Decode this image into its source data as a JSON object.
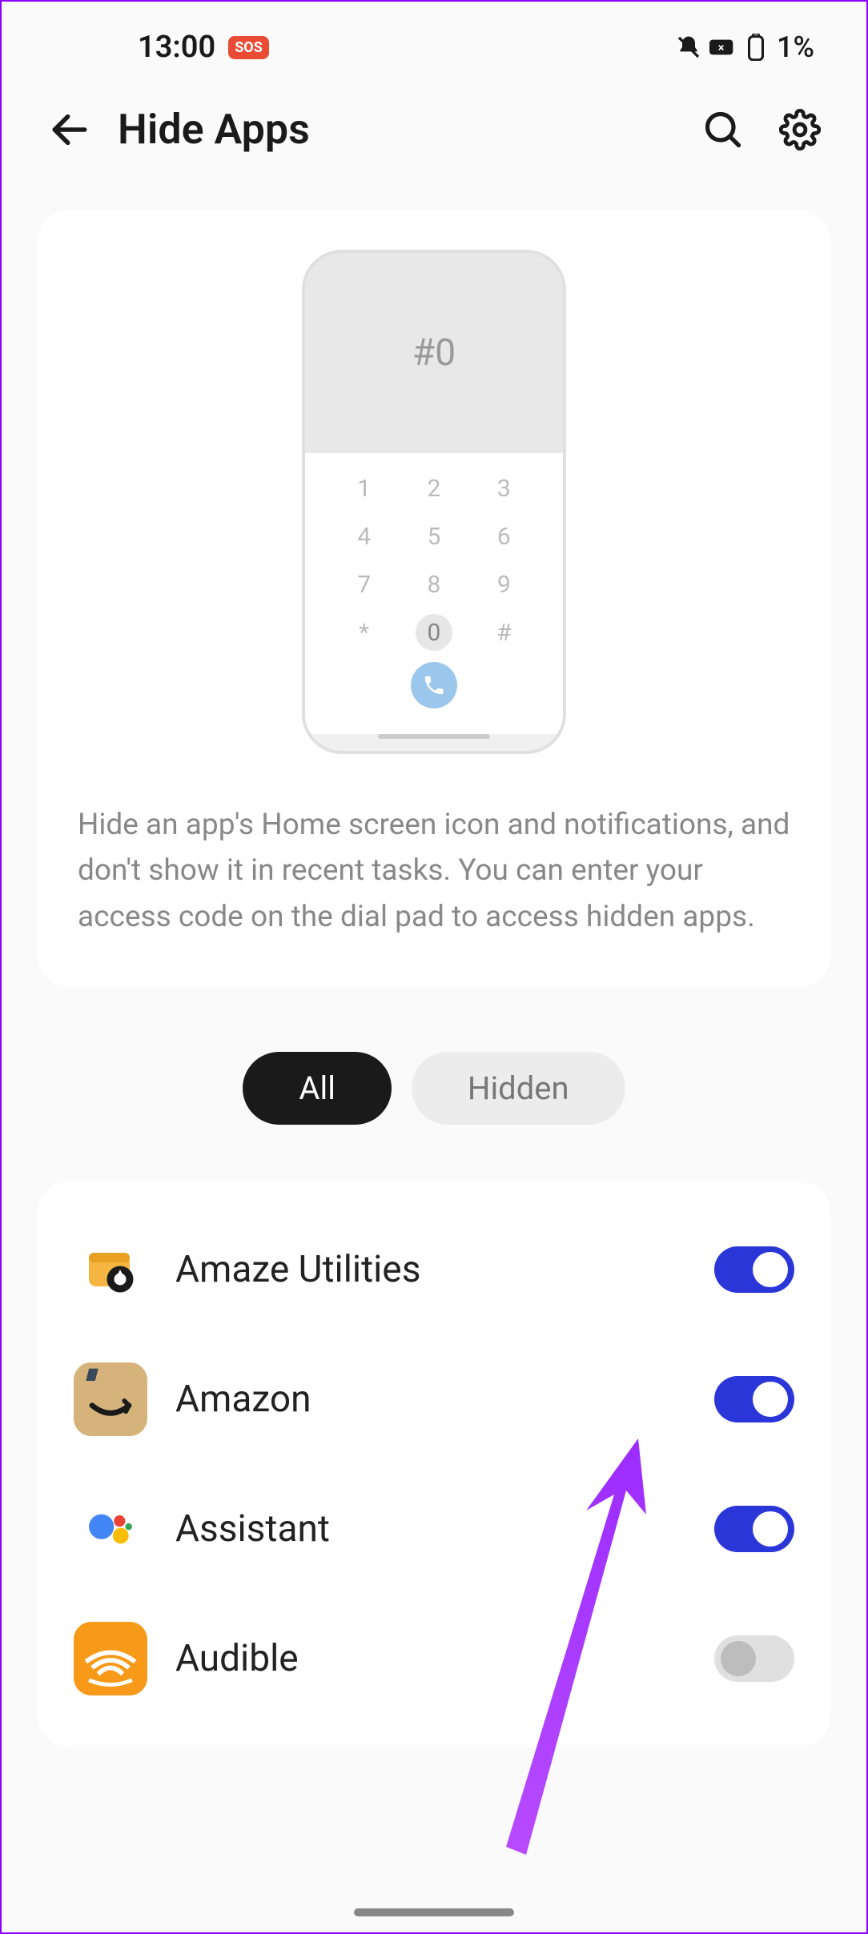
{
  "status_bar": {
    "time": "13:00",
    "sos_label": "SOS",
    "battery_text": "1%"
  },
  "header": {
    "title": "Hide Apps"
  },
  "info": {
    "code_display": "#0",
    "dialpad": [
      "1",
      "2",
      "3",
      "4",
      "5",
      "6",
      "7",
      "8",
      "9",
      "*",
      "0",
      "#"
    ],
    "description": "Hide an app's Home screen icon and notifications, and don't show it in recent tasks. You can enter your access code on the dial pad to access hidden apps."
  },
  "filters": {
    "all_label": "All",
    "hidden_label": "Hidden",
    "active": "all"
  },
  "apps": [
    {
      "name": "Amaze Utilities",
      "icon_bg": "#ffffff",
      "toggle": true
    },
    {
      "name": "Amazon",
      "icon_bg": "#d6b37a",
      "toggle": true
    },
    {
      "name": "Assistant",
      "icon_bg": "#ffffff",
      "toggle": true
    },
    {
      "name": "Audible",
      "icon_bg": "#f79a1a",
      "toggle": false
    }
  ]
}
